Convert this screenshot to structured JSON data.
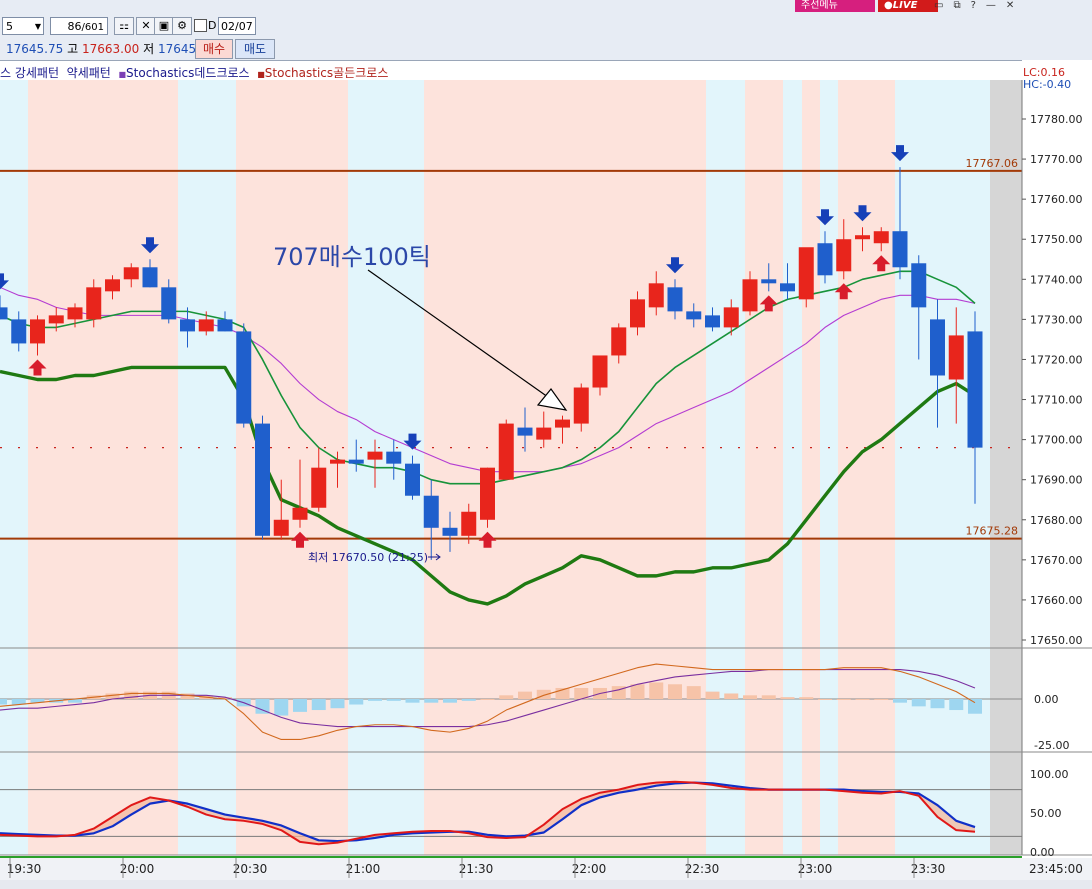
{
  "toolbar": {
    "interval": "5",
    "count_current": "86",
    "count_total": "/601",
    "date": "02/07",
    "checkbox_label": "D",
    "price_open": "17645.75",
    "label_high": "고",
    "price_high": "17663.00",
    "label_low": "저",
    "price_low": "17645.75",
    "buy_label": "매수",
    "sell_label": "매도",
    "menu_badge": "주선메뉴",
    "live_badge": "LIVE"
  },
  "colors": {
    "bull": "#e8251c",
    "bear": "#1f5fcc",
    "stripe_red": "#fde3dc",
    "stripe_blue": "#e2f5fb",
    "level_line": "#a33a08",
    "ma_green_thick": "#1f7a12",
    "ma_green_thin": "#17933a",
    "ma_purple": "#b43cd2"
  },
  "legend": [
    {
      "text": "스 강세패턴",
      "color": "#1a1a8c"
    },
    {
      "text": "약세패턴",
      "color": "#1a1a8c"
    },
    {
      "text": "Stochastics데드크로스",
      "color": "#1a1a8c"
    },
    {
      "text": "Stochastics골든크로스",
      "color": "#b0231c"
    }
  ],
  "axis_labels": {
    "lc": "LC:0.16",
    "hc": "HC:-0.40"
  },
  "chart_data": [
    {
      "type": "candlestick",
      "title": "",
      "ylim": [
        17645,
        17791
      ],
      "y_ticks": [
        17650,
        17660,
        17670,
        17680,
        17690,
        17700,
        17710,
        17720,
        17730,
        17740,
        17750,
        17760,
        17770,
        17780
      ],
      "y_tick_labels": [
        "17650.00",
        "17660.00",
        "17670.00",
        "17680.00",
        "17690.00",
        "17700.00",
        "17710.00",
        "17720.00",
        "17730.00",
        "17740.00",
        "17750.00",
        "17760.00",
        "17770.00",
        "17780.00"
      ],
      "x_tick_labels": [
        "19:30",
        "20:00",
        "20:30",
        "21:00",
        "21:30",
        "22:00",
        "22:30",
        "23:00",
        "23:30",
        "23:45:00"
      ],
      "levels": [
        {
          "value": 17767.06,
          "label": "17767.06"
        },
        {
          "value": 17675.28,
          "label": "17675.28"
        }
      ],
      "current_price": {
        "value": 17698.0,
        "label": "17698.00",
        "change": "-0.16%"
      },
      "low_note": "최저 17670.50 (21:25)",
      "annotation": "707매수100틱",
      "candles": [
        [
          17733,
          17736,
          17730,
          17730
        ],
        [
          17730,
          17732,
          17722,
          17724
        ],
        [
          17724,
          17731,
          17721,
          17730
        ],
        [
          17729,
          17733,
          17727,
          17731
        ],
        [
          17730,
          17734,
          17728,
          17733
        ],
        [
          17730,
          17740,
          17728,
          17738
        ],
        [
          17737,
          17741,
          17735,
          17740
        ],
        [
          17740,
          17744,
          17738,
          17743
        ],
        [
          17743,
          17745,
          17738,
          17738
        ],
        [
          17738,
          17740,
          17729,
          17730
        ],
        [
          17730,
          17733,
          17723,
          17727
        ],
        [
          17727,
          17732,
          17726,
          17730
        ],
        [
          17730,
          17732,
          17727,
          17727
        ],
        [
          17727,
          17729,
          17703,
          17704
        ],
        [
          17704,
          17706,
          17675,
          17676
        ],
        [
          17676,
          17690,
          17675,
          17680
        ],
        [
          17680,
          17695,
          17678,
          17683
        ],
        [
          17683,
          17698,
          17682,
          17693
        ],
        [
          17694,
          17697,
          17688,
          17695
        ],
        [
          17695,
          17700,
          17692,
          17694
        ],
        [
          17695,
          17700,
          17688,
          17697
        ],
        [
          17697,
          17700,
          17690,
          17694
        ],
        [
          17694,
          17696,
          17685,
          17686
        ],
        [
          17686,
          17690,
          17670,
          17678
        ],
        [
          17678,
          17682,
          17672,
          17676
        ],
        [
          17676,
          17684,
          17674,
          17682
        ],
        [
          17680,
          17693,
          17678,
          17693
        ],
        [
          17690,
          17705,
          17690,
          17704
        ],
        [
          17703,
          17708,
          17697,
          17701
        ],
        [
          17700,
          17707,
          17698,
          17703
        ],
        [
          17703,
          17706,
          17699,
          17705
        ],
        [
          17704,
          17714,
          17702,
          17713
        ],
        [
          17713,
          17721,
          17711,
          17721
        ],
        [
          17721,
          17729,
          17719,
          17728
        ],
        [
          17728,
          17737,
          17726,
          17735
        ],
        [
          17733,
          17742,
          17731,
          17739
        ],
        [
          17738,
          17740,
          17730,
          17732
        ],
        [
          17732,
          17734,
          17728,
          17730
        ],
        [
          17731,
          17733,
          17727,
          17728
        ],
        [
          17728,
          17735,
          17726,
          17733
        ],
        [
          17732,
          17742,
          17731,
          17740
        ],
        [
          17740,
          17744,
          17737,
          17739
        ],
        [
          17739,
          17744,
          17735,
          17737
        ],
        [
          17735,
          17747,
          17733,
          17748
        ],
        [
          17749,
          17752,
          17739,
          17741
        ],
        [
          17742,
          17755,
          17740,
          17750
        ],
        [
          17750,
          17753,
          17747,
          17751
        ],
        [
          17749,
          17753,
          17747,
          17752
        ],
        [
          17752,
          17768,
          17740,
          17743
        ],
        [
          17744,
          17746,
          17720,
          17733
        ],
        [
          17730,
          17735,
          17703,
          17716
        ],
        [
          17715,
          17733,
          17704,
          17726
        ],
        [
          17727,
          17732,
          17684,
          17698
        ]
      ],
      "ma_thin_green": [
        17731,
        17729,
        17728,
        17728,
        17729,
        17730,
        17731,
        17732,
        17732,
        17732,
        17732,
        17731,
        17730,
        17728,
        17720,
        17711,
        17703,
        17698,
        17695,
        17694,
        17693,
        17693,
        17692,
        17690,
        17689,
        17689,
        17689,
        17690,
        17691,
        17692,
        17693,
        17695,
        17698,
        17702,
        17708,
        17714,
        17718,
        17721,
        17724,
        17727,
        17730,
        17733,
        17735,
        17736,
        17737,
        17738,
        17740,
        17741,
        17742,
        17742,
        17740,
        17738,
        17734
      ],
      "ma_purple": [
        17738,
        17736,
        17735,
        17733,
        17732,
        17731,
        17731,
        17731,
        17731,
        17731,
        17730,
        17729,
        17728,
        17726,
        17723,
        17719,
        17714,
        17710,
        17707,
        17705,
        17702,
        17700,
        17698,
        17696,
        17694,
        17693,
        17692,
        17692,
        17692,
        17692,
        17693,
        17694,
        17696,
        17698,
        17701,
        17704,
        17706,
        17708,
        17710,
        17712,
        17715,
        17718,
        17721,
        17724,
        17728,
        17731,
        17733,
        17735,
        17736,
        17736,
        17735,
        17735,
        17734
      ],
      "ma_thick_green": [
        17717,
        17716,
        17715,
        17715,
        17716,
        17716,
        17717,
        17718,
        17718,
        17718,
        17718,
        17718,
        17718,
        17710,
        17695,
        17685,
        17683,
        17681,
        17678,
        17676,
        17674,
        17672,
        17670,
        17666,
        17662,
        17660,
        17659,
        17661,
        17664,
        17666,
        17668,
        17671,
        17670,
        17668,
        17666,
        17666,
        17667,
        17667,
        17668,
        17668,
        17669,
        17670,
        17674,
        17680,
        17686,
        17692,
        17697,
        17700,
        17704,
        17708,
        17712,
        17714,
        17711
      ],
      "down_arrows_at": [
        0,
        8,
        22,
        36,
        44,
        46,
        48
      ],
      "up_arrows_at": [
        2,
        16,
        26,
        41,
        45,
        47
      ]
    },
    {
      "type": "histogram",
      "title": "",
      "ylim": [
        -40,
        28
      ],
      "y_tick_labels": [
        "0.00",
        "-25.00"
      ],
      "y_ticks": [
        0,
        -25
      ],
      "hist": [
        -3,
        -3,
        -2,
        -2,
        -2,
        2,
        3,
        4,
        4,
        4,
        3,
        2,
        1,
        -4,
        -8,
        -9,
        -7,
        -6,
        -5,
        -3,
        -1,
        -1,
        -2,
        -2,
        -2,
        -1,
        0,
        2,
        4,
        5,
        6,
        6,
        6,
        7,
        8,
        9,
        8,
        7,
        4,
        3,
        2,
        2,
        1,
        1,
        0,
        0,
        0,
        0,
        -2,
        -4,
        -5,
        -6,
        -8
      ],
      "macd": [
        -4,
        -3,
        -2,
        -1,
        0,
        1,
        2,
        3,
        3,
        3,
        2,
        1,
        0,
        -8,
        -18,
        -22,
        -22,
        -20,
        -17,
        -15,
        -14,
        -14,
        -15,
        -17,
        -18,
        -16,
        -12,
        -6,
        -2,
        2,
        5,
        8,
        11,
        14,
        17,
        19,
        18,
        17,
        16,
        16,
        16,
        16,
        16,
        16,
        16,
        17,
        17,
        17,
        15,
        12,
        8,
        4,
        -2
      ],
      "signal": [
        -6,
        -5,
        -5,
        -4,
        -3,
        -2,
        0,
        1,
        2,
        2,
        2,
        2,
        1,
        -2,
        -6,
        -10,
        -13,
        -14,
        -15,
        -15,
        -15,
        -15,
        -15,
        -15,
        -15,
        -15,
        -14,
        -12,
        -9,
        -6,
        -3,
        0,
        3,
        5,
        8,
        10,
        12,
        13,
        14,
        15,
        15,
        16,
        16,
        16,
        16,
        16,
        16,
        16,
        16,
        15,
        13,
        10,
        6
      ]
    },
    {
      "type": "line",
      "title": "",
      "ylim": [
        -2,
        120
      ],
      "y_tick_labels": [
        "100.00",
        "50.00",
        "0.00"
      ],
      "y_ticks": [
        100,
        50,
        0
      ],
      "reference_lines": [
        80,
        20
      ],
      "k_red": [
        22,
        21,
        20,
        20,
        22,
        30,
        45,
        60,
        70,
        66,
        58,
        48,
        42,
        40,
        36,
        28,
        13,
        10,
        12,
        17,
        22,
        24,
        26,
        27,
        27,
        24,
        19,
        18,
        19,
        35,
        55,
        68,
        76,
        80,
        86,
        89,
        90,
        89,
        86,
        82,
        80,
        80,
        80,
        80,
        80,
        78,
        76,
        75,
        78,
        72,
        45,
        28,
        26
      ],
      "d_blue": [
        24,
        23,
        22,
        21,
        21,
        24,
        33,
        48,
        62,
        66,
        62,
        55,
        48,
        44,
        40,
        34,
        24,
        15,
        14,
        15,
        18,
        22,
        24,
        25,
        26,
        26,
        22,
        20,
        21,
        25,
        42,
        60,
        70,
        76,
        80,
        85,
        88,
        89,
        88,
        85,
        82,
        80,
        80,
        80,
        80,
        80,
        78,
        77,
        77,
        75,
        60,
        40,
        32
      ]
    }
  ]
}
